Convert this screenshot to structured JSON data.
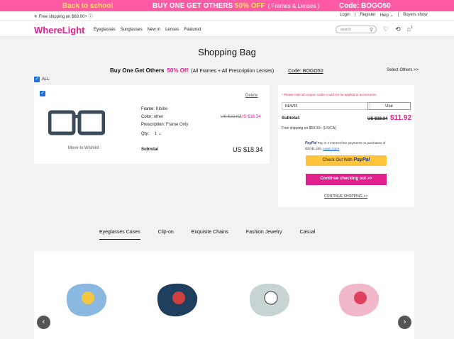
{
  "promo": {
    "left": "Back to school",
    "center_pre": "BUY ONE GET OTHERS",
    "center_hl": "50% OFF",
    "center_sub": "( Frames & Lenses )",
    "code": "Code: BOGO50"
  },
  "topbar": {
    "shipping": "Free shipping on $69.00+",
    "login": "Login",
    "sep": "|",
    "register": "Register",
    "help": "Help ⌄",
    "buyers": "Buyers show"
  },
  "header": {
    "logo": "WhereLight",
    "nav": [
      "Eyeglasses",
      "Sunglasses",
      "New in",
      "Lenses",
      "Featured"
    ],
    "search_placeholder": "search",
    "cart_count": "1"
  },
  "page": {
    "title": "Shopping Bag"
  },
  "offer": {
    "main": "Buy One Get Others",
    "pct": "50% Off",
    "desc": "(All Frames + All Prescription Lenses)",
    "code": "Code: BOGO50",
    "select_others": "Select Others >>"
  },
  "all_label": "ALL",
  "item": {
    "delete": "Delete",
    "move_to_wishlist": "Move to Wishlist",
    "frame_label": "Frame:",
    "frame_value": "Kibibe",
    "color_label": "Color:",
    "color_value": "other",
    "prescription_label": "Prescription:",
    "prescription_value": "Frame Only",
    "qty_label": "Qty:",
    "qty_value": "1",
    "old_price": "US $22.92",
    "new_price": "US $18.34",
    "subtotal_label": "Subtotal",
    "subtotal": "US $18.34"
  },
  "summary": {
    "note": "* Please note all coupon codes could not be applied to accessories.",
    "coupon_value": "NEW35",
    "use": "Use",
    "subtotal_label": "Subtotal:",
    "old_total": "US $18.34",
    "new_total": "$11.92",
    "free_ship": "Free shipping on $69.00+ (US/CA)",
    "paypal_brand": "PayPal",
    "paypal_text": "Pay in 4 interest-free payments on purchases of $30-$1,500.",
    "paypal_learn": "Learn more",
    "paypal_btn": "Check Out With",
    "paypal_btn_brand": "PayPal",
    "checkout": "Continue checking out >>",
    "continue_shopping": "CONTINUE SHOPPING >>"
  },
  "tabs": [
    "Eyeglasses Cases",
    "Clip-on",
    "Exquisite Chains",
    "Fashion Jewelry",
    "Casual"
  ],
  "colors": {
    "accent": "#e0208c",
    "promo": "#ff5aa5",
    "paypal_yellow": "#ffc439",
    "checkbox": "#1e6fd9"
  }
}
